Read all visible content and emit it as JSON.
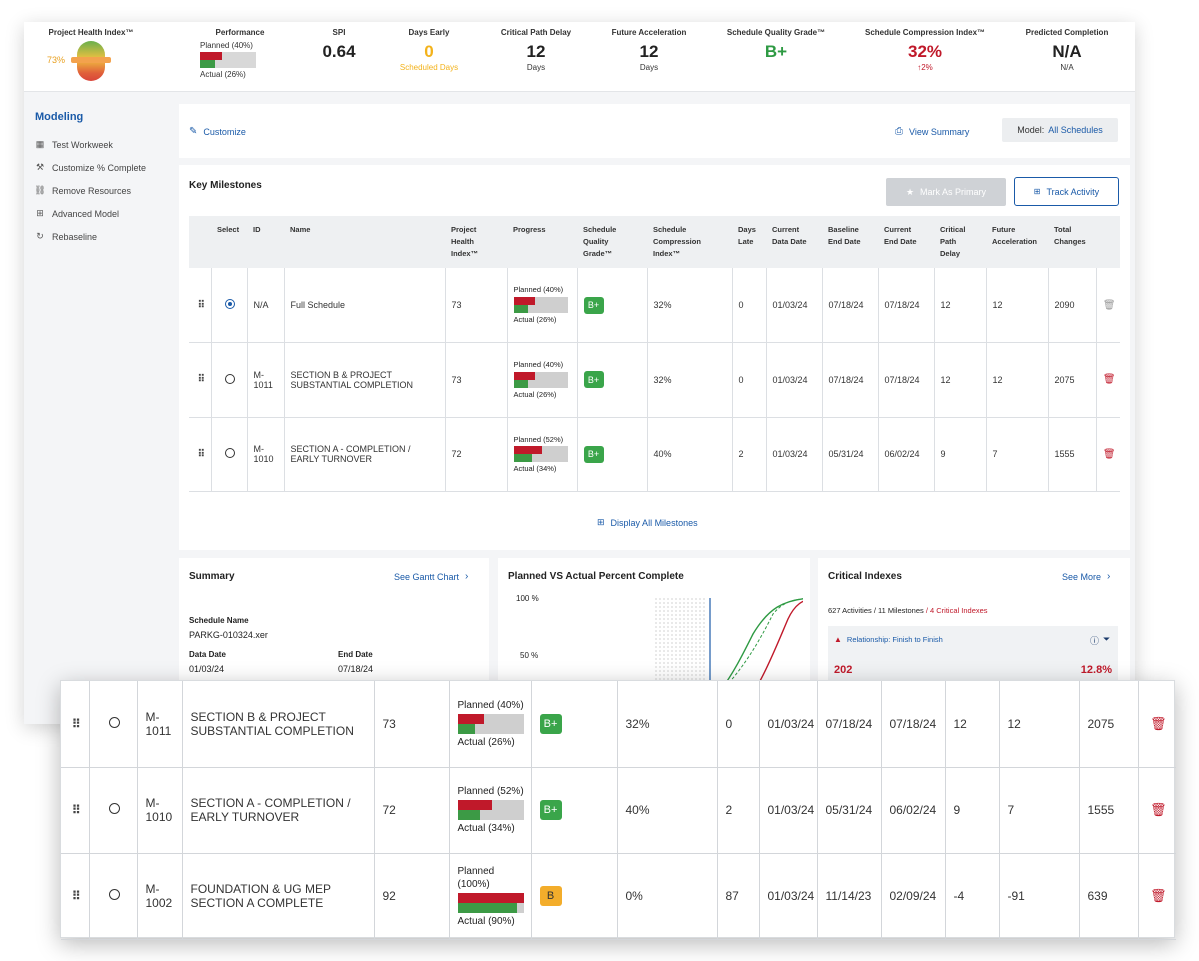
{
  "kpis": {
    "health": {
      "title": "Project Health Index™",
      "value": "73%"
    },
    "performance": {
      "title": "Performance",
      "planned": "Planned (40%)",
      "actual": "Actual (26%)",
      "planned_pct": 40,
      "actual_pct": 26
    },
    "spi": {
      "title": "SPI",
      "value": "0.64"
    },
    "days_early": {
      "title": "Days Early",
      "value": "0",
      "sub": "Scheduled Days"
    },
    "critical_path": {
      "title": "Critical Path Delay",
      "value": "12",
      "sub": "Days"
    },
    "future_accel": {
      "title": "Future Acceleration",
      "value": "12",
      "sub": "Days"
    },
    "quality": {
      "title": "Schedule Quality Grade™",
      "value": "B+"
    },
    "compression": {
      "title": "Schedule Compression Index™",
      "value": "32%",
      "sub": "↑2%"
    },
    "predicted": {
      "title": "Predicted Completion",
      "value": "N/A",
      "sub": "N/A"
    }
  },
  "colors": {
    "accent": "#1a5aa8",
    "green": "#2e9a43",
    "red": "#c0192a",
    "amber": "#f3b21a"
  },
  "sidebar": {
    "title": "Modeling",
    "items": [
      {
        "label": "Test Workweek",
        "icon": "calendar-icon"
      },
      {
        "label": "Customize % Complete",
        "icon": "hammer-icon"
      },
      {
        "label": "Remove Resources",
        "icon": "unlink-icon"
      },
      {
        "label": "Advanced Model",
        "icon": "grid-icon"
      },
      {
        "label": "Rebaseline",
        "icon": "refresh-icon"
      }
    ]
  },
  "toolbar": {
    "customize": "Customize",
    "view_summary": "View Summary",
    "model_label": "Model:",
    "model_value": "All Schedules"
  },
  "milestones": {
    "title": "Key Milestones",
    "mark_primary": "Mark As Primary",
    "track_activity": "Track Activity",
    "display_all": "Display All Milestones",
    "headers": {
      "select": "Select",
      "id": "ID",
      "name": "Name",
      "phi": [
        "Project",
        "Health",
        "Index™"
      ],
      "progress": "Progress",
      "sqg": [
        "Schedule",
        "Quality",
        "Grade™"
      ],
      "sci": [
        "Schedule",
        "Compression",
        "Index™"
      ],
      "days_late": [
        "Days",
        "Late"
      ],
      "cur_data": [
        "Current",
        "Data Date"
      ],
      "base_end": [
        "Baseline",
        "End Date"
      ],
      "cur_end": [
        "Current",
        "End Date"
      ],
      "cpd": [
        "Critical",
        "Path",
        "Delay"
      ],
      "future": [
        "Future",
        "Acceleration"
      ],
      "total": [
        "Total",
        "Changes"
      ]
    },
    "rows": [
      {
        "id": "N/A",
        "name": "Full Schedule",
        "phi": "73",
        "planned": "Planned (40%)",
        "actual": "Actual (26%)",
        "planned_pct": 40,
        "actual_pct": 26,
        "grade": "B+",
        "sci": "32%",
        "days_late": "0",
        "cur_data": "01/03/24",
        "base_end": "07/18/24",
        "cur_end": "07/18/24",
        "cpd": "12",
        "future": "12",
        "total": "2090"
      },
      {
        "id": "M-1011",
        "name": "SECTION B & PROJECT SUBSTANTIAL COMPLETION",
        "phi": "73",
        "planned": "Planned (40%)",
        "actual": "Actual (26%)",
        "planned_pct": 40,
        "actual_pct": 26,
        "grade": "B+",
        "sci": "32%",
        "days_late": "0",
        "cur_data": "01/03/24",
        "base_end": "07/18/24",
        "cur_end": "07/18/24",
        "cpd": "12",
        "future": "12",
        "total": "2075"
      },
      {
        "id": "M-1010",
        "name": "SECTION A - COMPLETION / EARLY TURNOVER",
        "phi": "72",
        "planned": "Planned (52%)",
        "actual": "Actual (34%)",
        "planned_pct": 52,
        "actual_pct": 34,
        "grade": "B+",
        "sci": "40%",
        "days_late": "2",
        "cur_data": "01/03/24",
        "base_end": "05/31/24",
        "cur_end": "06/02/24",
        "cpd": "9",
        "future": "7",
        "total": "1555"
      }
    ]
  },
  "summary": {
    "title": "Summary",
    "link": "See Gantt Chart",
    "schedule_name_label": "Schedule Name",
    "schedule_name": "PARKG-010324.xer",
    "data_date_label": "Data Date",
    "data_date": "01/03/24",
    "end_date_label": "End Date",
    "end_date": "07/18/24"
  },
  "chart": {
    "title": "Planned VS Actual Percent Complete",
    "y100": "100 %",
    "y50": "50 %"
  },
  "critical": {
    "title": "Critical Indexes",
    "link": "See More",
    "stats": "627 Activities / 11 Milestones",
    "crit": "/ 4 Critical Indexes",
    "relationship": "Relationship: Finish to Finish",
    "count": "202",
    "pct": "12.8%"
  },
  "zoom_rows": [
    {
      "id": "M-1011",
      "name": "SECTION B & PROJECT SUBSTANTIAL COMPLETION",
      "phi": "73",
      "planned": "Planned (40%)",
      "actual": "Actual (26%)",
      "planned_pct": 40,
      "actual_pct": 26,
      "grade": "B+",
      "sci": "32%",
      "days_late": "0",
      "cur_data": "01/03/24",
      "base_end": "07/18/24",
      "cur_end": "07/18/24",
      "cpd": "12",
      "future": "12",
      "total": "2075"
    },
    {
      "id": "M-1010",
      "name": "SECTION A - COMPLETION / EARLY TURNOVER",
      "phi": "72",
      "planned": "Planned (52%)",
      "actual": "Actual (34%)",
      "planned_pct": 52,
      "actual_pct": 34,
      "grade": "B+",
      "sci": "40%",
      "days_late": "2",
      "cur_data": "01/03/24",
      "base_end": "05/31/24",
      "cur_end": "06/02/24",
      "cpd": "9",
      "future": "7",
      "total": "1555"
    },
    {
      "id": "M-1002",
      "name": "FOUNDATION & UG MEP SECTION A COMPLETE",
      "phi": "92",
      "planned": "Planned (100%)",
      "actual": "Actual (90%)",
      "planned_pct": 100,
      "actual_pct": 90,
      "grade": "B",
      "sci": "0%",
      "days_late": "87",
      "cur_data": "01/03/24",
      "base_end": "11/14/23",
      "cur_end": "02/09/24",
      "cpd": "-4",
      "future": "-91",
      "total": "639"
    }
  ]
}
